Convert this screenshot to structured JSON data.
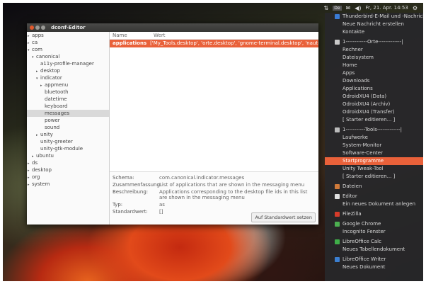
{
  "panel": {
    "indicators": [
      "⇅",
      "De",
      "✉",
      "◀)"
    ],
    "clock": "Fr, 21. Apr. 14:53",
    "gear": "⚙"
  },
  "window": {
    "title": "dconf-Editor"
  },
  "tree": [
    {
      "label": "apps",
      "depth": 0,
      "arrow": "▸"
    },
    {
      "label": "ca",
      "depth": 0,
      "arrow": "▸"
    },
    {
      "label": "com",
      "depth": 0,
      "arrow": "▾"
    },
    {
      "label": "canonical",
      "depth": 1,
      "arrow": "▾"
    },
    {
      "label": "a11y-profile-manager",
      "depth": 2,
      "arrow": ""
    },
    {
      "label": "desktop",
      "depth": 2,
      "arrow": "▸"
    },
    {
      "label": "indicator",
      "depth": 2,
      "arrow": "▾"
    },
    {
      "label": "appmenu",
      "depth": 3,
      "arrow": "▸"
    },
    {
      "label": "bluetooth",
      "depth": 3,
      "arrow": ""
    },
    {
      "label": "datetime",
      "depth": 3,
      "arrow": ""
    },
    {
      "label": "keyboard",
      "depth": 3,
      "arrow": ""
    },
    {
      "label": "messages",
      "depth": 3,
      "arrow": "",
      "selected": true
    },
    {
      "label": "power",
      "depth": 3,
      "arrow": ""
    },
    {
      "label": "sound",
      "depth": 3,
      "arrow": ""
    },
    {
      "label": "unity",
      "depth": 2,
      "arrow": "▸"
    },
    {
      "label": "unity-greeter",
      "depth": 2,
      "arrow": ""
    },
    {
      "label": "unity-gtk-module",
      "depth": 2,
      "arrow": ""
    },
    {
      "label": "ubuntu",
      "depth": 1,
      "arrow": "▸"
    },
    {
      "label": "ds",
      "depth": 0,
      "arrow": "▸"
    },
    {
      "label": "desktop",
      "depth": 0,
      "arrow": "▸"
    },
    {
      "label": "org",
      "depth": 0,
      "arrow": "▸"
    },
    {
      "label": "system",
      "depth": 0,
      "arrow": "▸"
    }
  ],
  "columns": {
    "name": "Name",
    "value": "Wert"
  },
  "key": {
    "name": "applications",
    "value": "['My_Tools.desktop', 'orte.desktop', 'gnome-terminal.desktop', 'nautilus.de"
  },
  "details": {
    "schema_label": "Schema:",
    "schema_value": "com.canonical.indicator.messages",
    "summary_label": "Zusammenfassung:",
    "summary_value": "List of applications that are shown in the messaging menu",
    "description_label": "Beschreibung:",
    "description_value": "Applications corresponding to the desktop file ids in this list are shown in the messaging menu",
    "type_label": "Typ:",
    "type_value": "as",
    "default_label": "Standardwert:",
    "default_value": "[]",
    "reset_button": "Auf Standardwert setzen"
  },
  "menu": [
    {
      "label": "Thunderbird-E-Mail und -Nachrichten",
      "icon": "thunderbird-icon",
      "color": "#3a7bd5"
    },
    {
      "label": "Neue Nachricht erstellen"
    },
    {
      "label": "Kontakte"
    },
    {
      "label": ""
    },
    {
      "label": "1------------Orte-------------|",
      "icon": "folder-icon",
      "color": "#c9c9c9"
    },
    {
      "label": "Rechner"
    },
    {
      "label": "Dateisystem"
    },
    {
      "label": "Home"
    },
    {
      "label": "Apps"
    },
    {
      "label": "Downloads"
    },
    {
      "label": "Applications"
    },
    {
      "label": "OdroidXU4 (Data)"
    },
    {
      "label": "OdroidXU4 (Archiv)"
    },
    {
      "label": "OdroidXU4 (Transfer)"
    },
    {
      "label": "[ Starter editieren... ]"
    },
    {
      "label": ""
    },
    {
      "label": "1-----------Tools-------------|",
      "icon": "monitor-icon",
      "color": "#bbbbbb"
    },
    {
      "label": "Laufwerke"
    },
    {
      "label": "System-Monitor"
    },
    {
      "label": "Software-Center"
    },
    {
      "label": "Startprogramme",
      "highlight": true
    },
    {
      "label": "Unity Tweak-Tool"
    },
    {
      "label": "[ Starter editieren... ]"
    },
    {
      "label": ""
    },
    {
      "label": "Dateien",
      "icon": "files-icon",
      "color": "#d07a3a"
    },
    {
      "label": ""
    },
    {
      "label": "Editor",
      "icon": "editor-icon",
      "color": "#e0e0e0"
    },
    {
      "label": "Ein neues Dokument anlegen"
    },
    {
      "label": ""
    },
    {
      "label": "FileZilla",
      "icon": "filezilla-icon",
      "color": "#d63b2a"
    },
    {
      "label": ""
    },
    {
      "label": "Google Chrome",
      "icon": "chrome-icon",
      "color": "#4caf50"
    },
    {
      "label": "Incognito Fenster"
    },
    {
      "label": ""
    },
    {
      "label": "LibreOffice Calc",
      "icon": "calc-icon",
      "color": "#3fae49"
    },
    {
      "label": "Neues Tabellendokument"
    },
    {
      "label": ""
    },
    {
      "label": "LibreOffice Writer",
      "icon": "writer-icon",
      "color": "#3b7fd1"
    },
    {
      "label": "Neues Dokument"
    }
  ]
}
